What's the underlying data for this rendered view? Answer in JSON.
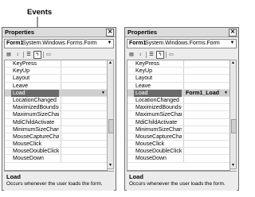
{
  "callout": {
    "label": "Events"
  },
  "panels": [
    {
      "title": "Properties",
      "object_name": "Form1",
      "object_type": "System.Windows.Forms.Form",
      "active_button": "events",
      "rows": [
        {
          "name": "KeyPress",
          "value": ""
        },
        {
          "name": "KeyUp",
          "value": ""
        },
        {
          "name": "Layout",
          "value": ""
        },
        {
          "name": "Leave",
          "value": ""
        },
        {
          "name": "Load",
          "value": "",
          "selected": true
        },
        {
          "name": "LocationChanged",
          "value": ""
        },
        {
          "name": "MaximizedBoundsChar",
          "value": ""
        },
        {
          "name": "MaximumSizeChanged",
          "value": ""
        },
        {
          "name": "MdiChildActivate",
          "value": ""
        },
        {
          "name": "MinimumSizeChanged",
          "value": ""
        },
        {
          "name": "MouseCaptureChange",
          "value": ""
        },
        {
          "name": "MouseClick",
          "value": ""
        },
        {
          "name": "MouseDoubleClick",
          "value": ""
        },
        {
          "name": "MouseDown",
          "value": ""
        }
      ],
      "description": {
        "title": "Load",
        "text": "Occurs whenever the user loads the form."
      }
    },
    {
      "title": "Properties",
      "object_name": "Form1",
      "object_type": "System.Windows.Forms.Form",
      "active_button": "events",
      "rows": [
        {
          "name": "KeyPress",
          "value": ""
        },
        {
          "name": "KeyUp",
          "value": ""
        },
        {
          "name": "Layout",
          "value": ""
        },
        {
          "name": "Leave",
          "value": ""
        },
        {
          "name": "Load",
          "value": "Form1_Load",
          "selected": true
        },
        {
          "name": "LocationChanged",
          "value": ""
        },
        {
          "name": "MaximizedBoundsChar",
          "value": ""
        },
        {
          "name": "MaximumSizeChanged",
          "value": ""
        },
        {
          "name": "MdiChildActivate",
          "value": ""
        },
        {
          "name": "MinimumSizeChanged",
          "value": ""
        },
        {
          "name": "MouseCaptureChange",
          "value": ""
        },
        {
          "name": "MouseClick",
          "value": ""
        },
        {
          "name": "MouseDoubleClick",
          "value": ""
        },
        {
          "name": "MouseDown",
          "value": ""
        }
      ],
      "description": {
        "title": "Load",
        "text": "Occurs whenever the user loads the form."
      }
    }
  ],
  "toolbar_icons": [
    "categorized-icon",
    "alphabetical-icon",
    "properties-icon",
    "events-icon",
    "property-pages-icon"
  ],
  "icons": {
    "close": "close-icon",
    "dropdown": "chevron-down-icon"
  }
}
